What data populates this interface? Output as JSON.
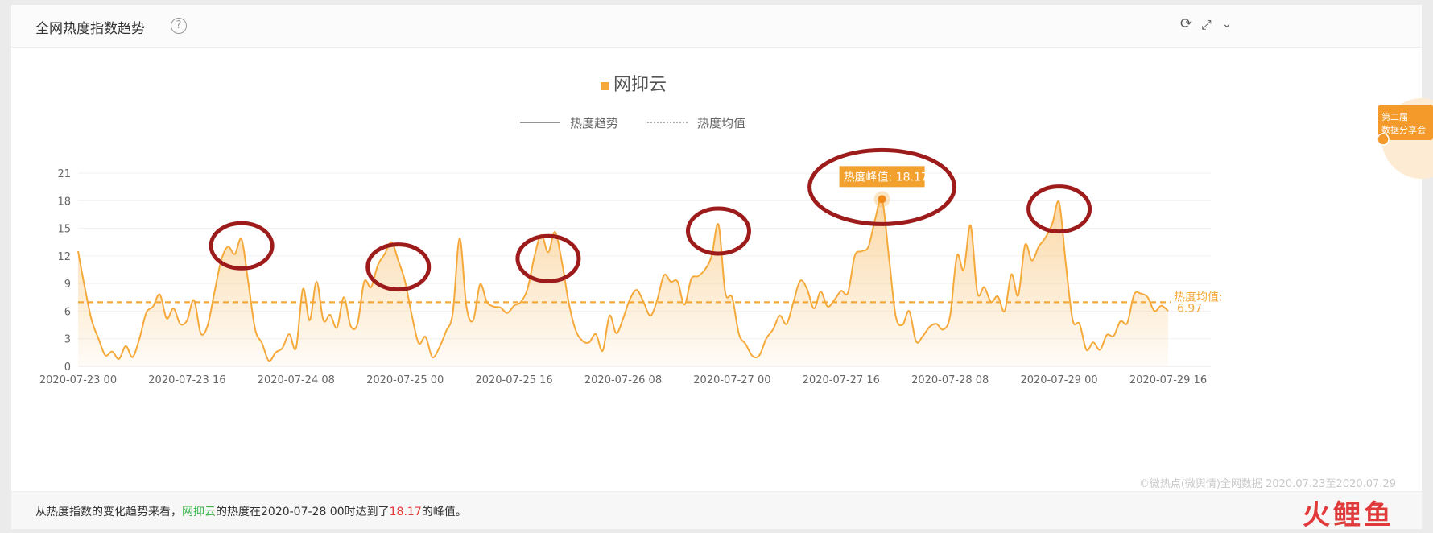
{
  "header": {
    "title": "全网热度指数趋势",
    "help_icon": "question-circle-icon",
    "toolbar_icons": [
      "refresh-icon",
      "expand-icon",
      "chevron-down-icon"
    ]
  },
  "chart_data": {
    "type": "area",
    "title": "网抑云",
    "legend": {
      "items": [
        "热度趋势",
        "热度均值"
      ],
      "placement": "top-center"
    },
    "series": [
      {
        "name": "网抑云"
      }
    ],
    "color": "#f5a93a",
    "ylim": [
      0,
      21
    ],
    "yticks": [
      0,
      3,
      6,
      9,
      12,
      15,
      18,
      21
    ],
    "xlim": [
      0,
      160
    ],
    "xtick_labels": [
      "2020-07-23 00",
      "2020-07-23 16",
      "2020-07-24 08",
      "2020-07-25 00",
      "2020-07-25 16",
      "2020-07-26 08",
      "2020-07-27 00",
      "2020-07-27 16",
      "2020-07-28 08",
      "2020-07-29 00",
      "2020-07-29 16"
    ],
    "xtick_hours": [
      0,
      16,
      32,
      48,
      64,
      80,
      96,
      112,
      128,
      144,
      160
    ],
    "keypoints": [
      [
        0,
        12.5
      ],
      [
        1,
        8.5
      ],
      [
        2,
        5
      ],
      [
        3,
        3
      ],
      [
        4,
        1.2
      ],
      [
        5,
        1.6
      ],
      [
        6,
        0.8
      ],
      [
        7,
        2.2
      ],
      [
        8,
        1
      ],
      [
        9,
        3
      ],
      [
        10,
        5.8
      ],
      [
        11,
        6.5
      ],
      [
        12,
        7.8
      ],
      [
        13,
        5.2
      ],
      [
        14,
        6.3
      ],
      [
        15,
        4.6
      ],
      [
        16,
        5
      ],
      [
        17,
        7.2
      ],
      [
        18,
        3.6
      ],
      [
        19,
        4.4
      ],
      [
        20,
        8
      ],
      [
        21,
        11.5
      ],
      [
        22,
        13
      ],
      [
        23,
        12.2
      ],
      [
        24,
        13.8
      ],
      [
        25,
        9
      ],
      [
        26,
        4
      ],
      [
        27,
        2.5
      ],
      [
        28,
        0.6
      ],
      [
        29,
        1.5
      ],
      [
        30,
        2
      ],
      [
        31,
        3.5
      ],
      [
        32,
        2
      ],
      [
        33,
        8.4
      ],
      [
        34,
        5
      ],
      [
        35,
        9.2
      ],
      [
        36,
        5
      ],
      [
        37,
        5.6
      ],
      [
        38,
        4.2
      ],
      [
        39,
        7.5
      ],
      [
        40,
        4.4
      ],
      [
        41,
        4.6
      ],
      [
        42,
        9.2
      ],
      [
        43,
        8.6
      ],
      [
        44,
        11
      ],
      [
        45,
        12.2
      ],
      [
        46,
        13.5
      ],
      [
        47,
        11.5
      ],
      [
        48,
        9.2
      ],
      [
        49,
        5.5
      ],
      [
        50,
        2.5
      ],
      [
        51,
        3.2
      ],
      [
        52,
        1
      ],
      [
        53,
        2
      ],
      [
        54,
        3.8
      ],
      [
        55,
        5.8
      ],
      [
        56,
        13.9
      ],
      [
        57,
        6.5
      ],
      [
        58,
        5
      ],
      [
        59,
        8.9
      ],
      [
        60,
        7
      ],
      [
        61,
        6.5
      ],
      [
        62,
        6.4
      ],
      [
        63,
        5.8
      ],
      [
        64,
        6.6
      ],
      [
        65,
        7
      ],
      [
        66,
        8.5
      ],
      [
        67,
        12
      ],
      [
        68,
        14.3
      ],
      [
        69,
        12.4
      ],
      [
        70,
        14.6
      ],
      [
        71,
        11.4
      ],
      [
        72,
        7
      ],
      [
        73,
        4
      ],
      [
        74,
        2.8
      ],
      [
        75,
        2.6
      ],
      [
        76,
        3.5
      ],
      [
        77,
        1.7
      ],
      [
        78,
        5.5
      ],
      [
        79,
        3.6
      ],
      [
        80,
        5.2
      ],
      [
        81,
        7.3
      ],
      [
        82,
        8.3
      ],
      [
        83,
        7
      ],
      [
        84,
        5.5
      ],
      [
        85,
        7.2
      ],
      [
        86,
        9.9
      ],
      [
        87,
        9.2
      ],
      [
        88,
        9.2
      ],
      [
        89,
        6.7
      ],
      [
        90,
        9.5
      ],
      [
        91,
        9.8
      ],
      [
        92,
        10.5
      ],
      [
        93,
        12
      ],
      [
        94,
        15.4
      ],
      [
        95,
        8
      ],
      [
        96,
        7.5
      ],
      [
        97,
        3.5
      ],
      [
        98,
        2.4
      ],
      [
        99,
        1.1
      ],
      [
        100,
        1.2
      ],
      [
        101,
        3
      ],
      [
        102,
        4
      ],
      [
        103,
        5.5
      ],
      [
        104,
        4.6
      ],
      [
        105,
        7
      ],
      [
        106,
        9.3
      ],
      [
        107,
        8.4
      ],
      [
        108,
        6.3
      ],
      [
        109,
        8.1
      ],
      [
        110,
        6.5
      ],
      [
        111,
        7.2
      ],
      [
        112,
        8.2
      ],
      [
        113,
        8
      ],
      [
        114,
        12
      ],
      [
        115,
        12.5
      ],
      [
        116,
        13
      ],
      [
        117,
        16
      ],
      [
        118,
        18.17
      ],
      [
        119,
        12
      ],
      [
        120,
        5.5
      ],
      [
        121,
        4.5
      ],
      [
        122,
        6
      ],
      [
        123,
        2.7
      ],
      [
        124,
        3.3
      ],
      [
        125,
        4.3
      ],
      [
        126,
        4.6
      ],
      [
        127,
        4
      ],
      [
        128,
        5.5
      ],
      [
        129,
        12
      ],
      [
        130,
        10.5
      ],
      [
        131,
        15.3
      ],
      [
        132,
        8
      ],
      [
        133,
        8.6
      ],
      [
        134,
        7
      ],
      [
        135,
        7.6
      ],
      [
        136,
        6
      ],
      [
        137,
        10
      ],
      [
        138,
        7.7
      ],
      [
        139,
        13.2
      ],
      [
        140,
        11.5
      ],
      [
        141,
        13
      ],
      [
        142,
        14
      ],
      [
        143,
        15.5
      ],
      [
        144,
        17.8
      ],
      [
        145,
        11
      ],
      [
        146,
        5
      ],
      [
        147,
        4.6
      ],
      [
        148,
        1.8
      ],
      [
        149,
        2.6
      ],
      [
        150,
        1.8
      ],
      [
        151,
        3.4
      ],
      [
        152,
        3.3
      ],
      [
        153,
        4.9
      ],
      [
        154,
        4.7
      ],
      [
        155,
        7.8
      ],
      [
        156,
        7.9
      ],
      [
        157,
        7.5
      ],
      [
        158,
        6
      ],
      [
        159,
        6.6
      ],
      [
        160,
        6
      ]
    ],
    "mean": {
      "value": 6.97,
      "label": "热度均值:",
      "value_label": "6.97"
    },
    "peak": {
      "x": 118,
      "value": 18.17,
      "label": "热度峰值: 18.17"
    },
    "highlight_hours": [
      24,
      47,
      69,
      94,
      118,
      144
    ],
    "annotation_color": "#9e1b1b",
    "grid": true
  },
  "footer": {
    "summary_prefix": "从热度指数的变化趋势来看，",
    "summary_keyword": "网抑云",
    "summary_mid": "的热度在2020-07-28 00时达到了",
    "summary_value": "18.17",
    "summary_suffix": "的峰值。"
  },
  "copyright": "©微热点(微舆情)全网数据 2020.07.23至2020.07.29",
  "badge": {
    "line1": "第二届",
    "line2": "数据分享会"
  },
  "watermark": "火鲤鱼"
}
